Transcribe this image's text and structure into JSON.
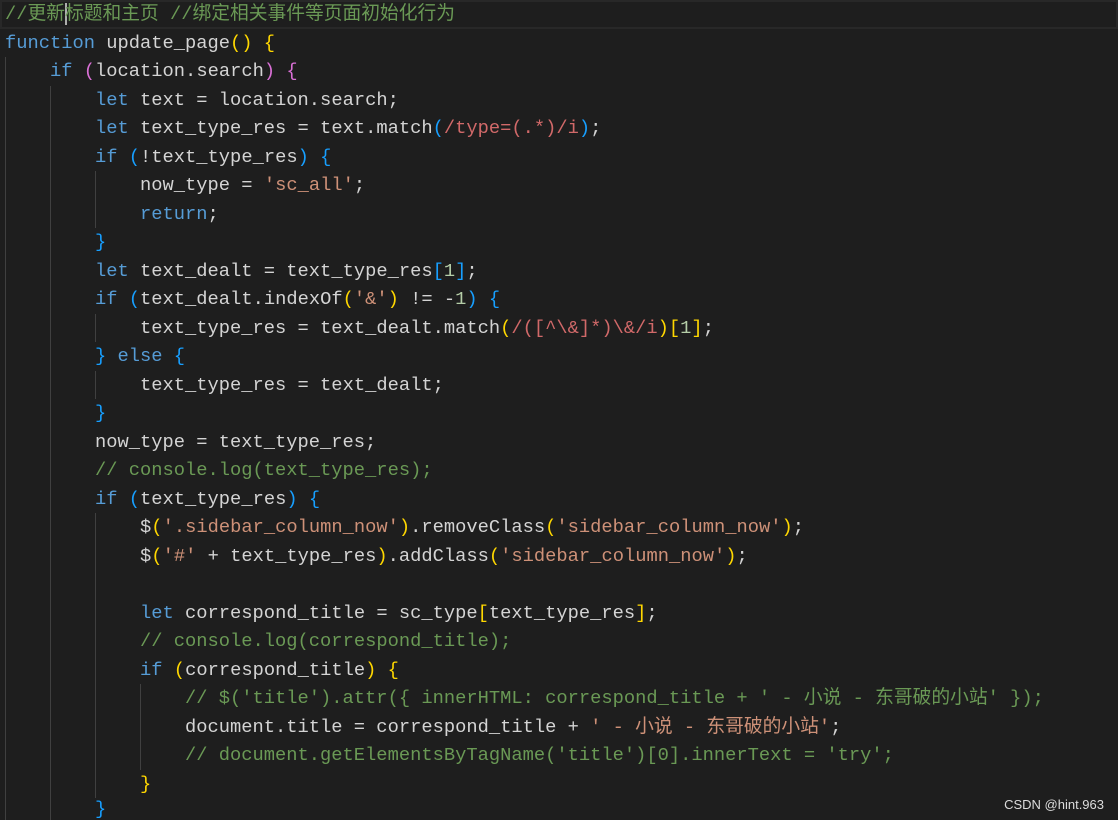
{
  "editor": {
    "cursor": {
      "line": 1,
      "column": 5
    },
    "lines": [
      {
        "indent": 0,
        "tokens": [
          {
            "cm": "//更新"
          },
          {
            "cm": "标题和主页 //绑定相关事件等页面初始化行为"
          }
        ]
      },
      {
        "indent": 0,
        "tokens": [
          {
            "kw": "function"
          },
          {
            "id": " update_page"
          },
          {
            "b1": "() {"
          }
        ]
      },
      {
        "indent": 1,
        "tokens": [
          {
            "kw": "if"
          },
          {
            "b2": " ("
          },
          {
            "id": "location.search"
          },
          {
            "b2": ") {"
          }
        ]
      },
      {
        "indent": 2,
        "tokens": [
          {
            "kw": "let"
          },
          {
            "id": " text = location.search;"
          }
        ]
      },
      {
        "indent": 2,
        "tokens": [
          {
            "kw": "let"
          },
          {
            "id": " text_type_res = text.match"
          },
          {
            "b3": "("
          },
          {
            "rx": "/type=(.*)/i"
          },
          {
            "b3": ")"
          },
          {
            "id": ";"
          }
        ]
      },
      {
        "indent": 2,
        "tokens": [
          {
            "kw": "if"
          },
          {
            "b3": " ("
          },
          {
            "id": "!text_type_res"
          },
          {
            "b3": ") {"
          }
        ]
      },
      {
        "indent": 3,
        "tokens": [
          {
            "id": "now_type = "
          },
          {
            "str": "'sc_all'"
          },
          {
            "id": ";"
          }
        ]
      },
      {
        "indent": 3,
        "tokens": [
          {
            "kw": "return"
          },
          {
            "id": ";"
          }
        ]
      },
      {
        "indent": 2,
        "tokens": [
          {
            "b3": "}"
          }
        ]
      },
      {
        "indent": 2,
        "tokens": [
          {
            "kw": "let"
          },
          {
            "id": " text_dealt = text_type_res"
          },
          {
            "b3": "["
          },
          {
            "num": "1"
          },
          {
            "b3": "]"
          },
          {
            "id": ";"
          }
        ]
      },
      {
        "indent": 2,
        "tokens": [
          {
            "kw": "if"
          },
          {
            "b3": " ("
          },
          {
            "id": "text_dealt.indexOf"
          },
          {
            "b1": "("
          },
          {
            "str": "'&'"
          },
          {
            "b1": ")"
          },
          {
            "id": " != -"
          },
          {
            "num": "1"
          },
          {
            "b3": ") {"
          }
        ]
      },
      {
        "indent": 3,
        "tokens": [
          {
            "id": "text_type_res = text_dealt.match"
          },
          {
            "b1": "("
          },
          {
            "rx": "/([^\\&]*)\\&/i"
          },
          {
            "b1": ")["
          },
          {
            "num": "1"
          },
          {
            "b1": "]"
          },
          {
            "id": ";"
          }
        ]
      },
      {
        "indent": 2,
        "tokens": [
          {
            "b3": "} "
          },
          {
            "kw": "else"
          },
          {
            "b3": " {"
          }
        ]
      },
      {
        "indent": 3,
        "tokens": [
          {
            "id": "text_type_res = text_dealt;"
          }
        ]
      },
      {
        "indent": 2,
        "tokens": [
          {
            "b3": "}"
          }
        ]
      },
      {
        "indent": 2,
        "tokens": [
          {
            "id": "now_type = text_type_res;"
          }
        ]
      },
      {
        "indent": 2,
        "tokens": [
          {
            "cm": "// console.log(text_type_res);"
          }
        ]
      },
      {
        "indent": 2,
        "tokens": [
          {
            "kw": "if"
          },
          {
            "b3": " ("
          },
          {
            "id": "text_type_res"
          },
          {
            "b3": ") {"
          }
        ]
      },
      {
        "indent": 3,
        "tokens": [
          {
            "id": "$"
          },
          {
            "b1": "("
          },
          {
            "str": "'.sidebar_column_now'"
          },
          {
            "b1": ")"
          },
          {
            "id": ".removeClass"
          },
          {
            "b1": "("
          },
          {
            "str": "'sidebar_column_now'"
          },
          {
            "b1": ")"
          },
          {
            "id": ";"
          }
        ]
      },
      {
        "indent": 3,
        "tokens": [
          {
            "id": "$"
          },
          {
            "b1": "("
          },
          {
            "str": "'#'"
          },
          {
            "id": " + text_type_res"
          },
          {
            "b1": ")"
          },
          {
            "id": ".addClass"
          },
          {
            "b1": "("
          },
          {
            "str": "'sidebar_column_now'"
          },
          {
            "b1": ")"
          },
          {
            "id": ";"
          }
        ]
      },
      {
        "indent": 3,
        "tokens": []
      },
      {
        "indent": 3,
        "tokens": [
          {
            "kw": "let"
          },
          {
            "id": " correspond_title = sc_type"
          },
          {
            "b1": "["
          },
          {
            "id": "text_type_res"
          },
          {
            "b1": "]"
          },
          {
            "id": ";"
          }
        ]
      },
      {
        "indent": 3,
        "tokens": [
          {
            "cm": "// console.log(correspond_title);"
          }
        ]
      },
      {
        "indent": 3,
        "tokens": [
          {
            "kw": "if"
          },
          {
            "b1": " ("
          },
          {
            "id": "correspond_title"
          },
          {
            "b1": ") {"
          }
        ]
      },
      {
        "indent": 4,
        "tokens": [
          {
            "cm": "// $('title').attr({ innerHTML: correspond_title + ' - 小说 - 东哥破的小站' });"
          }
        ]
      },
      {
        "indent": 4,
        "tokens": [
          {
            "id": "document.title = correspond_title + "
          },
          {
            "str": "' - 小说 - 东哥破的小站'"
          },
          {
            "id": ";"
          }
        ]
      },
      {
        "indent": 4,
        "tokens": [
          {
            "cm": "// document.getElementsByTagName('title')[0].innerText = 'try';"
          }
        ]
      },
      {
        "indent": 3,
        "tokens": [
          {
            "b1": "}"
          }
        ]
      },
      {
        "indent": 2,
        "tokens": [
          {
            "b3": "}"
          }
        ]
      }
    ]
  },
  "syntax_colors": {
    "cm": "#6a9955",
    "kw": "#569cd6",
    "id": "#d4d4d4",
    "str": "#ce9178",
    "rx": "#d16969",
    "num": "#b5cea8",
    "b1": "#ffd700",
    "b2": "#da70d6",
    "b3": "#179fff"
  },
  "theme": {
    "background": "#1e1e1e",
    "indent_guide": "#404040",
    "current_line_border": "#282828",
    "cursor": "#aeafad",
    "watermark": "#dcdcdc"
  },
  "watermark": "CSDN @hint.963"
}
